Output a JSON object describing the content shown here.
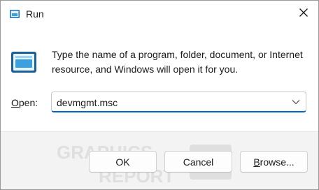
{
  "window": {
    "title": "Run"
  },
  "main": {
    "description": "Type the name of a program, folder, document, or Internet resource, and Windows will open it for you.",
    "open_label_underlined": "O",
    "open_label_rest": "pen:",
    "open_value": "devmgmt.msc"
  },
  "buttons": {
    "ok_label": "OK",
    "cancel_label": "Cancel",
    "browse_underlined": "B",
    "browse_rest": "rowse..."
  },
  "icons": {
    "title": "run-icon",
    "big": "run-icon",
    "close": "close-icon",
    "dropdown": "chevron-down-icon"
  },
  "colors": {
    "accent": "#0067c0",
    "icon_blue": "#3aa0e0",
    "footer_bg": "#f3f3f3"
  }
}
